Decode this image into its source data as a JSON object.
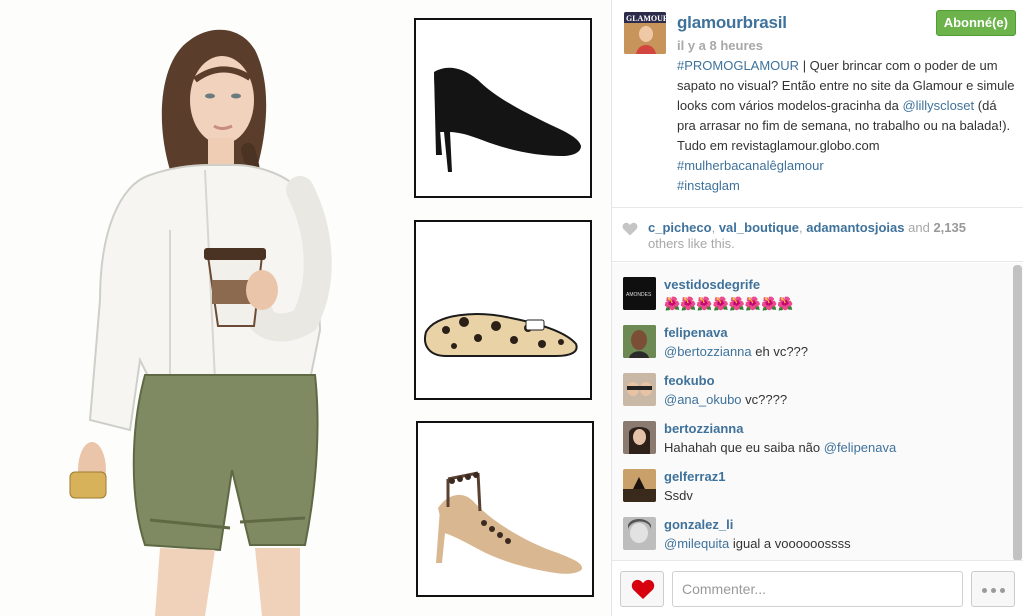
{
  "post": {
    "username": "glamourbrasil",
    "follow_label": "Abonné(e)",
    "timestamp": "il y a 8 heures",
    "caption": {
      "t1": "#PROMOGLAMOUR",
      "t2": " | Quer brincar com o poder de um sapato no visual? Então entre no site da Glamour e simule looks com vários modelos-gracinha da ",
      "t3": "@lillyscloset",
      "t4": " (dá pra arrasar no fim de semana, no trabalho ou na balada!). Tudo em revistaglamour.globo.com ",
      "t5": "#mulherbacanalêglamour",
      "t6": "#instaglam"
    },
    "avatar_text": "GLAMOUR"
  },
  "likes": {
    "user1": "c_picheco",
    "sep1": ", ",
    "user2": "val_boutique",
    "sep2": ", ",
    "user3": "adamantosjoias",
    "and": " and ",
    "count": "2,135",
    "suffix": " others like this."
  },
  "comments": [
    {
      "user": "vestidosdegrife",
      "text": "🌺🌺🌺🌺🌺🌺🌺🌺",
      "avatar": "AMONDES"
    },
    {
      "user": "felipenava",
      "mention": "@bertozzianna",
      "text": " eh vc???"
    },
    {
      "user": "feokubo",
      "mention": "@ana_okubo",
      "text": " vc????"
    },
    {
      "user": "bertozzianna",
      "text": "Hahahah que eu saiba não ",
      "mention": "@felipenava"
    },
    {
      "user": "gelferraz1",
      "text": "Ssdv"
    },
    {
      "user": "gonzalez_li",
      "mention": "@milequita",
      "text": " igual a voooooossss"
    }
  ],
  "footer": {
    "comment_placeholder": "Commenter..."
  },
  "colors": {
    "link": "#3f729b",
    "follow_green": "#6bb34a",
    "heart_red": "#d6000f",
    "muted": "#a8a8a8"
  },
  "icons": [
    "heart-icon",
    "like-heart-icon",
    "more-dots-icon"
  ]
}
